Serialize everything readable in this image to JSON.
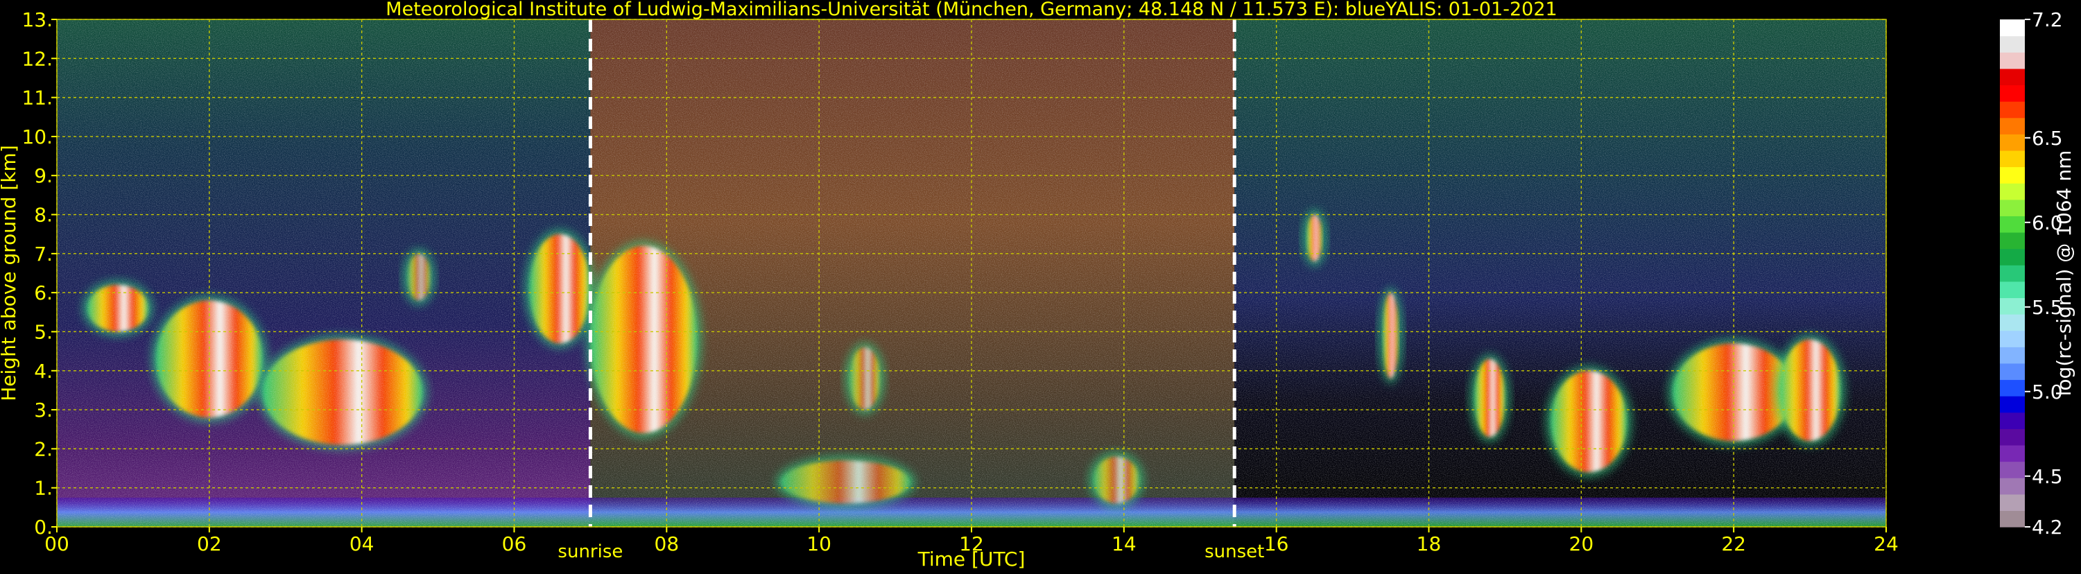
{
  "chart_data": [
    {
      "type": "heatmap",
      "title": "Meteorological Institute of Ludwig-Maximilians-Universität (München, Germany; 48.148 N / 11.573 E):    blueYALIS: 01-01-2021",
      "xlabel": "Time [UTC]",
      "ylabel": "Height above ground [km]",
      "xlim": [
        0,
        24
      ],
      "ylim": [
        0,
        13
      ],
      "x_ticks": [
        0,
        2,
        4,
        6,
        8,
        10,
        12,
        14,
        16,
        18,
        20,
        22,
        24
      ],
      "x_tick_labels": [
        "00",
        "02",
        "04",
        "06",
        "08",
        "10",
        "12",
        "14",
        "16",
        "18",
        "20",
        "22",
        "24"
      ],
      "y_ticks": [
        0,
        1,
        2,
        3,
        4,
        5,
        6,
        7,
        8,
        9,
        10,
        11,
        12,
        13
      ],
      "y_tick_labels": [
        "0.",
        "1.",
        "2.",
        "3.",
        "4.",
        "5.",
        "6.",
        "7.",
        "8.",
        "9.",
        "10.",
        "11.",
        "12.",
        "13."
      ],
      "grid": true,
      "grid_color": "#c8c800",
      "text_color": "#ffff00",
      "annotations": [
        {
          "text": "sunrise",
          "x": 7.0,
          "line": "dashed",
          "color": "#ffffff"
        },
        {
          "text": "sunset",
          "x": 15.45,
          "line": "dashed",
          "color": "#ffffff"
        }
      ],
      "cloud_layers": [
        {
          "x": [
            0.4,
            1.2
          ],
          "y": [
            5.0,
            6.2
          ],
          "intensity": "high"
        },
        {
          "x": [
            1.3,
            2.7
          ],
          "y": [
            2.8,
            5.8
          ],
          "intensity": "high"
        },
        {
          "x": [
            2.7,
            4.8
          ],
          "y": [
            2.1,
            4.8
          ],
          "intensity": "high"
        },
        {
          "x": [
            4.6,
            4.9
          ],
          "y": [
            5.8,
            7.0
          ],
          "intensity": "medium"
        },
        {
          "x": [
            6.2,
            7.0
          ],
          "y": [
            4.7,
            7.5
          ],
          "intensity": "high"
        },
        {
          "x": [
            7.0,
            8.4
          ],
          "y": [
            2.4,
            7.2
          ],
          "intensity": "high"
        },
        {
          "x": [
            9.5,
            11.2
          ],
          "y": [
            0.6,
            1.7
          ],
          "intensity": "medium"
        },
        {
          "x": [
            10.4,
            10.8
          ],
          "y": [
            3.0,
            4.6
          ],
          "intensity": "medium"
        },
        {
          "x": [
            13.6,
            14.2
          ],
          "y": [
            0.6,
            1.8
          ],
          "intensity": "medium"
        },
        {
          "x": [
            16.4,
            16.6
          ],
          "y": [
            6.8,
            8.0
          ],
          "intensity": "high"
        },
        {
          "x": [
            17.4,
            17.6
          ],
          "y": [
            3.8,
            6.0
          ],
          "intensity": "high"
        },
        {
          "x": [
            18.6,
            19.0
          ],
          "y": [
            2.3,
            4.3
          ],
          "intensity": "high"
        },
        {
          "x": [
            19.6,
            20.6
          ],
          "y": [
            1.4,
            4.0
          ],
          "intensity": "high"
        },
        {
          "x": [
            21.2,
            22.8
          ],
          "y": [
            2.2,
            4.7
          ],
          "intensity": "high"
        },
        {
          "x": [
            22.6,
            23.4
          ],
          "y": [
            2.2,
            4.8
          ],
          "intensity": "high"
        }
      ],
      "background_regions": [
        {
          "x": [
            0,
            7.0
          ],
          "description": "night, dark blue background noise"
        },
        {
          "x": [
            7.0,
            15.45
          ],
          "description": "day, brown/orange background noise"
        },
        {
          "x": [
            15.45,
            24
          ],
          "description": "night, dark blue background noise"
        }
      ]
    },
    {
      "type": "colorbar",
      "label": "log(rc-signal) @ 1064 nm",
      "range": [
        4.2,
        7.2
      ],
      "ticks": [
        4.2,
        4.5,
        5.0,
        5.5,
        6.0,
        6.5,
        7.2
      ],
      "tick_labels": [
        "4.2",
        "4.5",
        "5.0",
        "5.5",
        "6.0",
        "6.5",
        "7.2"
      ],
      "colors": [
        "#a08c96",
        "#b4a0b4",
        "#a078b4",
        "#8c50b4",
        "#7828b4",
        "#5a0aa0",
        "#3c00b4",
        "#0000dc",
        "#1e50ff",
        "#5a8cff",
        "#82b4ff",
        "#a0d2ff",
        "#aae6f0",
        "#8cf0d2",
        "#50e6aa",
        "#28c878",
        "#14aa46",
        "#28b432",
        "#50dc3c",
        "#8cf03c",
        "#c8ff32",
        "#ffff14",
        "#ffd200",
        "#ffa000",
        "#ff7800",
        "#ff3c00",
        "#ff0000",
        "#e60000",
        "#f0c8c8",
        "#e6e6e6",
        "#ffffff"
      ]
    }
  ]
}
